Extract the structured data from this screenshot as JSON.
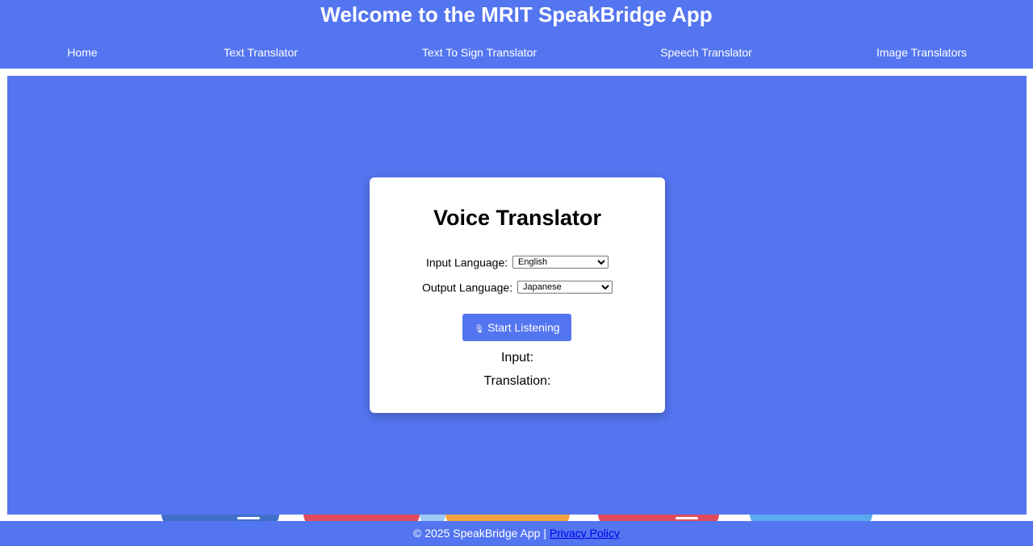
{
  "header": {
    "title": "Welcome to the MRIT SpeakBridge App",
    "nav": [
      {
        "label": "Home"
      },
      {
        "label": "Text Translator"
      },
      {
        "label": "Text To Sign Translator"
      },
      {
        "label": "Speech Translator"
      },
      {
        "label": "Image Translators"
      }
    ]
  },
  "card": {
    "title": "Voice Translator",
    "input_language_label": "Input Language:",
    "input_language_value": "English",
    "output_language_label": "Output Language:",
    "output_language_value": "Japanese",
    "start_button_label": "Start Listening",
    "start_button_icon": "microphone-icon",
    "input_label": "Input:",
    "translation_label": "Translation:"
  },
  "footer": {
    "copyright": "© 2025 SpeakBridge App | ",
    "privacy_link": "Privacy Policy"
  },
  "colors": {
    "brand": "#5475f0",
    "card_bg": "#ffffff",
    "link": "#0000ee"
  }
}
